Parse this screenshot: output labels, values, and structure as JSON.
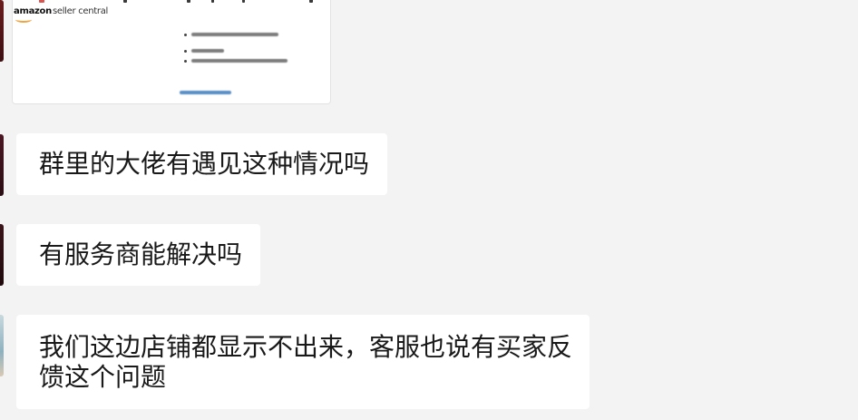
{
  "chat": {
    "image_message": {
      "logo_brand": "amazon",
      "logo_product": "seller central"
    },
    "messages": [
      {
        "text": "群里的大佬有遇见这种情况吗"
      },
      {
        "text": "有服务商能解决吗"
      },
      {
        "text": "我们这边店铺都显示不出来，客服也说有买家反馈这个问题"
      }
    ]
  },
  "colors": {
    "background": "#f3f3f3",
    "bubble": "#ffffff",
    "text": "#191919",
    "logo_smile": "#f0a23b"
  },
  "icons": [
    "avatar",
    "amazon-smile-icon"
  ]
}
